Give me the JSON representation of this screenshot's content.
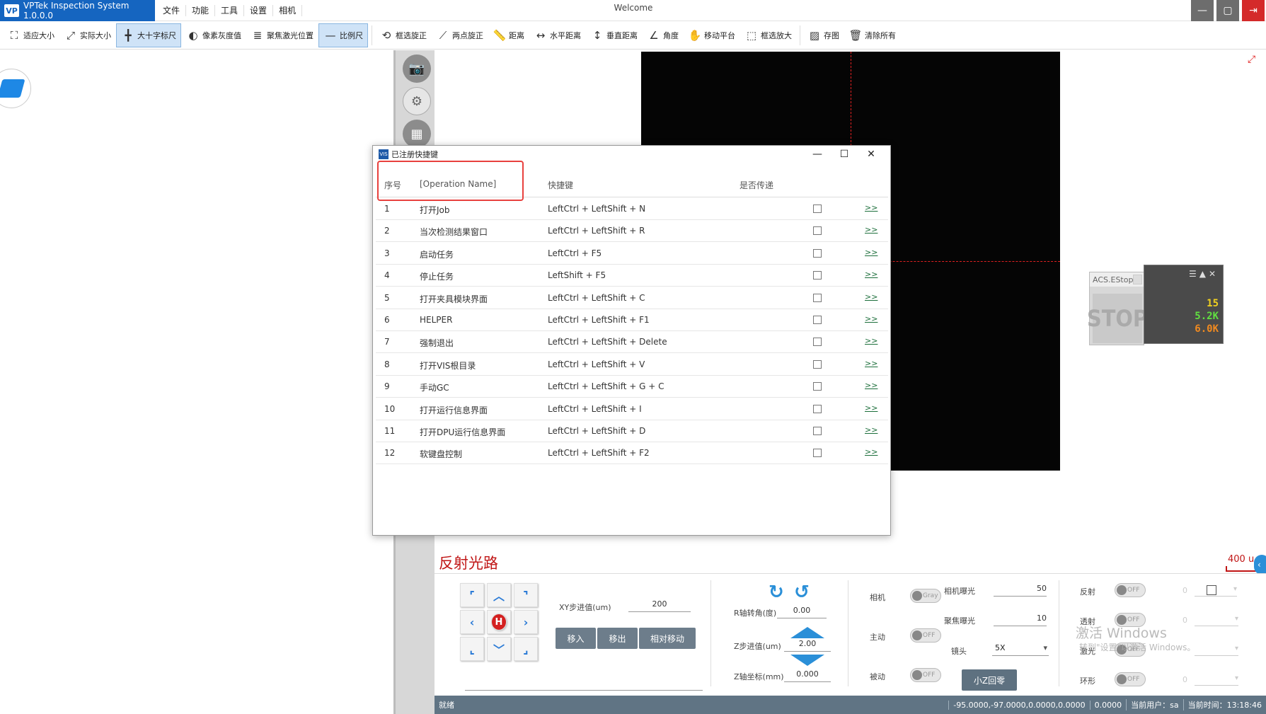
{
  "app": {
    "title": "VPTek Inspection System 1.0.0.0",
    "logo_text": "VP",
    "window_title": "Welcome",
    "menu": [
      "文件",
      "功能",
      "工具",
      "设置",
      "相机"
    ]
  },
  "toolbar": [
    {
      "label": "适应大小",
      "icon": "fit-icon"
    },
    {
      "label": "实际大小",
      "icon": "actual-size-icon"
    },
    {
      "label": "大十字标尺",
      "icon": "crosshair-icon",
      "active": true
    },
    {
      "label": "像素灰度值",
      "icon": "contrast-icon"
    },
    {
      "label": "聚焦激光位置",
      "icon": "focus-laser-icon"
    },
    {
      "label": "比例尺",
      "icon": "scale-icon",
      "active": true
    },
    {
      "label": "框选旋正",
      "icon": "rotate-select-icon"
    },
    {
      "label": "两点旋正",
      "icon": "two-point-icon"
    },
    {
      "label": "距离",
      "icon": "ruler-icon"
    },
    {
      "label": "水平距离",
      "icon": "horizontal-distance-icon"
    },
    {
      "label": "垂直距离",
      "icon": "vertical-distance-icon"
    },
    {
      "label": "角度",
      "icon": "angle-icon"
    },
    {
      "label": "移动平台",
      "icon": "hand-icon"
    },
    {
      "label": "框选放大",
      "icon": "zoom-select-icon"
    },
    {
      "label": "存图",
      "icon": "image-save-icon"
    },
    {
      "label": "清除所有",
      "icon": "trash-icon"
    }
  ],
  "dialog": {
    "title": "已注册快捷键",
    "icon_text": "VIS",
    "headers": {
      "index": "序号",
      "operation": "[Operation Name]",
      "shortcut": "快捷键",
      "pass_through": "是否传递"
    },
    "link_text": ">>",
    "rows": [
      {
        "index": "1",
        "operation": "打开Job",
        "shortcut": "LeftCtrl + LeftShift + N"
      },
      {
        "index": "2",
        "operation": "当次检测结果窗口",
        "shortcut": "LeftCtrl + LeftShift + R"
      },
      {
        "index": "3",
        "operation": "启动任务",
        "shortcut": "LeftCtrl + F5"
      },
      {
        "index": "4",
        "operation": "停止任务",
        "shortcut": "LeftShift + F5"
      },
      {
        "index": "5",
        "operation": "打开夹具模块界面",
        "shortcut": "LeftCtrl + LeftShift + C"
      },
      {
        "index": "6",
        "operation": "HELPER",
        "shortcut": "LeftCtrl + LeftShift + F1"
      },
      {
        "index": "7",
        "operation": "强制退出",
        "shortcut": "LeftCtrl + LeftShift + Delete"
      },
      {
        "index": "8",
        "operation": "打开VIS根目录",
        "shortcut": "LeftCtrl + LeftShift + V"
      },
      {
        "index": "9",
        "operation": "手动GC",
        "shortcut": "LeftCtrl + LeftShift + G + C"
      },
      {
        "index": "10",
        "operation": "打开运行信息界面",
        "shortcut": "LeftCtrl + LeftShift + I"
      },
      {
        "index": "11",
        "operation": "打开DPU运行信息界面",
        "shortcut": "LeftCtrl + LeftShift + D"
      },
      {
        "index": "12",
        "operation": "软键盘控制",
        "shortcut": "LeftCtrl + LeftShift + F2"
      }
    ]
  },
  "acs": {
    "title": "ACS.EStop",
    "stop_text": "STOP"
  },
  "monitor": {
    "value1": "15",
    "value2": "5.2K",
    "value3": "6.0K",
    "colors": {
      "v1": "#f0d020",
      "v2": "#60e040",
      "v3": "#f08a20"
    }
  },
  "bottom": {
    "section_title": "反射光路",
    "ruler_label": "400 u",
    "xy_step_label": "XY步进值(um)",
    "xy_step_value": "200",
    "btn_move_in": "移入",
    "btn_move_out": "移出",
    "btn_relative": "相对移动",
    "r_angle_label": "R轴转角(度)",
    "r_angle_value": "0.00",
    "z_step_label": "Z步进值(um)",
    "z_step_value": "2.00",
    "z_coord_label": "Z轴坐标(mm)",
    "z_coord_value": "0.000",
    "camera_label": "相机",
    "camera_toggle": "Gray",
    "active_label": "主动",
    "passive_label": "被动",
    "off_text": "OFF",
    "cam_exposure_label": "相机曝光",
    "cam_exposure_value": "50",
    "focus_exposure_label": "聚焦曝光",
    "focus_exposure_value": "10",
    "lens_label": "镜头",
    "lens_value": "5X",
    "small_z_button": "小Z回零",
    "reflect_label": "反射",
    "transmit_label": "透射",
    "laser_label": "激光",
    "ring_label": "环形",
    "zero": "0",
    "home_label": "H"
  },
  "watermark": {
    "line1": "激活 Windows",
    "line2": "转到\"设置\"以激活 Windows。"
  },
  "status": {
    "left": "就绪",
    "coords": "-95.0000,-97.0000,0.0000,0.0000",
    "value": "0.0000",
    "user": "当前用户：sa",
    "time": "当前时间：13:18:46"
  },
  "colors": {
    "accent": "#1565c0",
    "highlight": "#e8413e",
    "status_bar": "#607484",
    "brand_red": "#c01515"
  }
}
